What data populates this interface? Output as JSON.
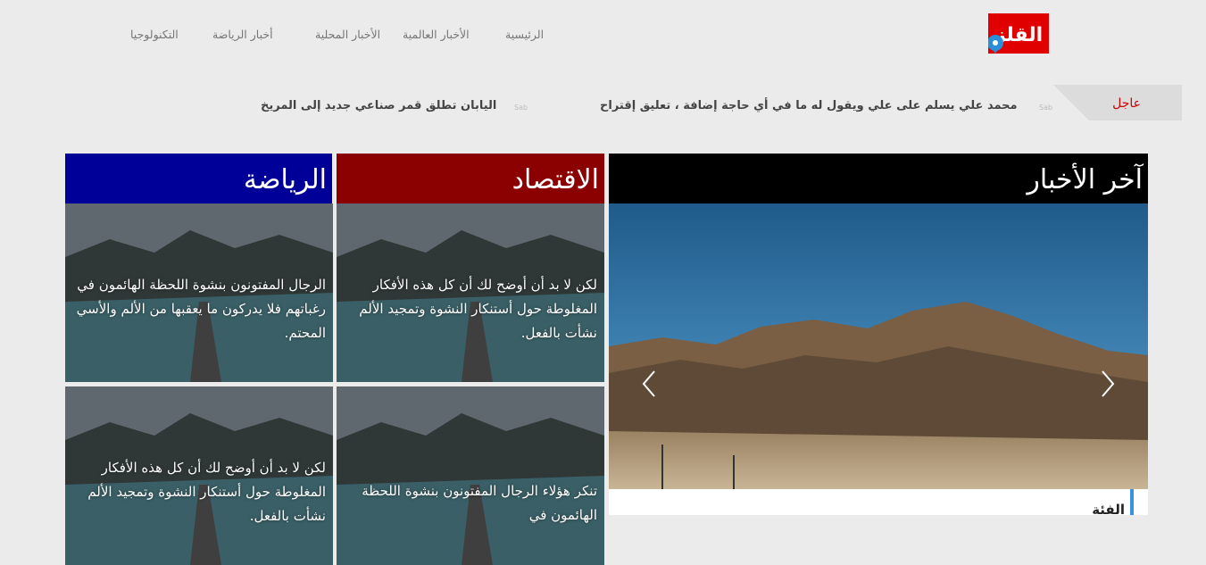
{
  "nav": {
    "items": [
      {
        "label": "الرئيسية"
      },
      {
        "label": "الأخبار العالمية"
      },
      {
        "label": "الأخبار المحلية"
      },
      {
        "label": "أخبار الرياضة"
      },
      {
        "label": "التكنولوجيا"
      }
    ]
  },
  "logo": {
    "text": "القلز"
  },
  "ticker": {
    "label": "عاجل",
    "items": [
      {
        "text": "محمد علي يسلم على علي ويقول له ما في أي حاجة إضافة ، تعليق إقتراح",
        "separator": "Sab"
      },
      {
        "text": "اليابان تطلق قمر صناعي جديد إلى المريخ",
        "separator": "Sab"
      }
    ]
  },
  "sections": {
    "latest": {
      "title": "آخر الأخبار",
      "caption": "الفئة",
      "color": "#000000"
    },
    "economy": {
      "title": "الاقتصاد",
      "color": "#8b0000"
    },
    "sports": {
      "title": "الرياضة",
      "color": "#000099"
    }
  },
  "tiles": {
    "economy_1": "لكن لا بد أن أوضح لك أن كل هذه الأفكار المغلوطة حول أستنكار النشوة وتمجيد الألم نشأت بالفعل.",
    "sports_1": "الرجال المفتونون بنشوة اللحظة الهائمون في رغباتهم فلا يدركون ما يعقبها من الألم والأسي المحتم.",
    "economy_2": "تنكر هؤلاء الرجال المفتونون بنشوة اللحظة الهائمون في",
    "sports_2": "لكن لا بد أن أوضح لك أن كل هذه الأفكار المغلوطة حول أستنكار النشوة وتمجيد الألم نشأت بالفعل."
  },
  "colors": {
    "accent": "#e10000",
    "background": "#ebebeb"
  }
}
